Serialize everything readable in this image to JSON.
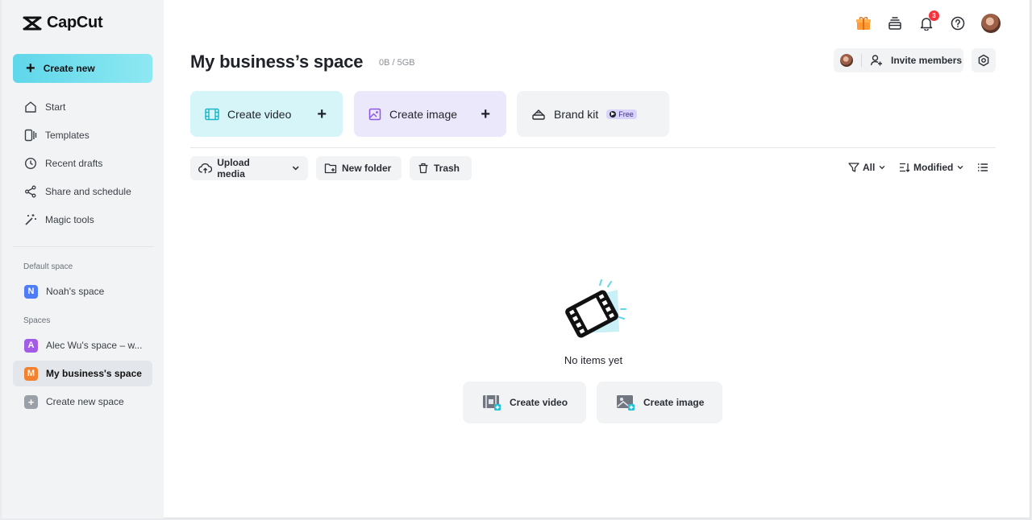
{
  "brand": {
    "name": "CapCut"
  },
  "sidebar": {
    "create_new_label": "Create new",
    "nav": [
      {
        "label": "Start",
        "icon": "home-icon"
      },
      {
        "label": "Templates",
        "icon": "templates-icon"
      },
      {
        "label": "Recent drafts",
        "icon": "clock-icon"
      },
      {
        "label": "Share and schedule",
        "icon": "share-icon"
      },
      {
        "label": "Magic tools",
        "icon": "magic-wand-icon"
      }
    ],
    "default_space_label": "Default space",
    "default_space": {
      "initial": "N",
      "name": "Noah's space",
      "color": "#4f7cf7"
    },
    "spaces_label": "Spaces",
    "spaces": [
      {
        "initial": "A",
        "name": "Alec Wu's space – w...",
        "color": "#a25ce8"
      },
      {
        "initial": "M",
        "name": "My business's space",
        "color": "#f2822f"
      }
    ],
    "create_space_label": "Create new space"
  },
  "header": {
    "notification_count": "3",
    "title": "My business’s space",
    "storage": "0B / 5GB",
    "invite_label": "Invite members"
  },
  "create_cards": {
    "video_label": "Create video",
    "image_label": "Create image",
    "brand_label": "Brand kit",
    "free_badge": "Free"
  },
  "toolbar": {
    "upload_label": "Upload media",
    "new_folder_label": "New folder",
    "trash_label": "Trash",
    "filter_label": "All",
    "sort_label": "Modified"
  },
  "empty_state": {
    "text": "No items yet",
    "create_video_label": "Create video",
    "create_image_label": "Create image"
  },
  "colors": {
    "accent": "#5fd7ea",
    "video_card": "#d6f5f9",
    "image_card": "#ece8fb",
    "badge": "#f5333f"
  }
}
